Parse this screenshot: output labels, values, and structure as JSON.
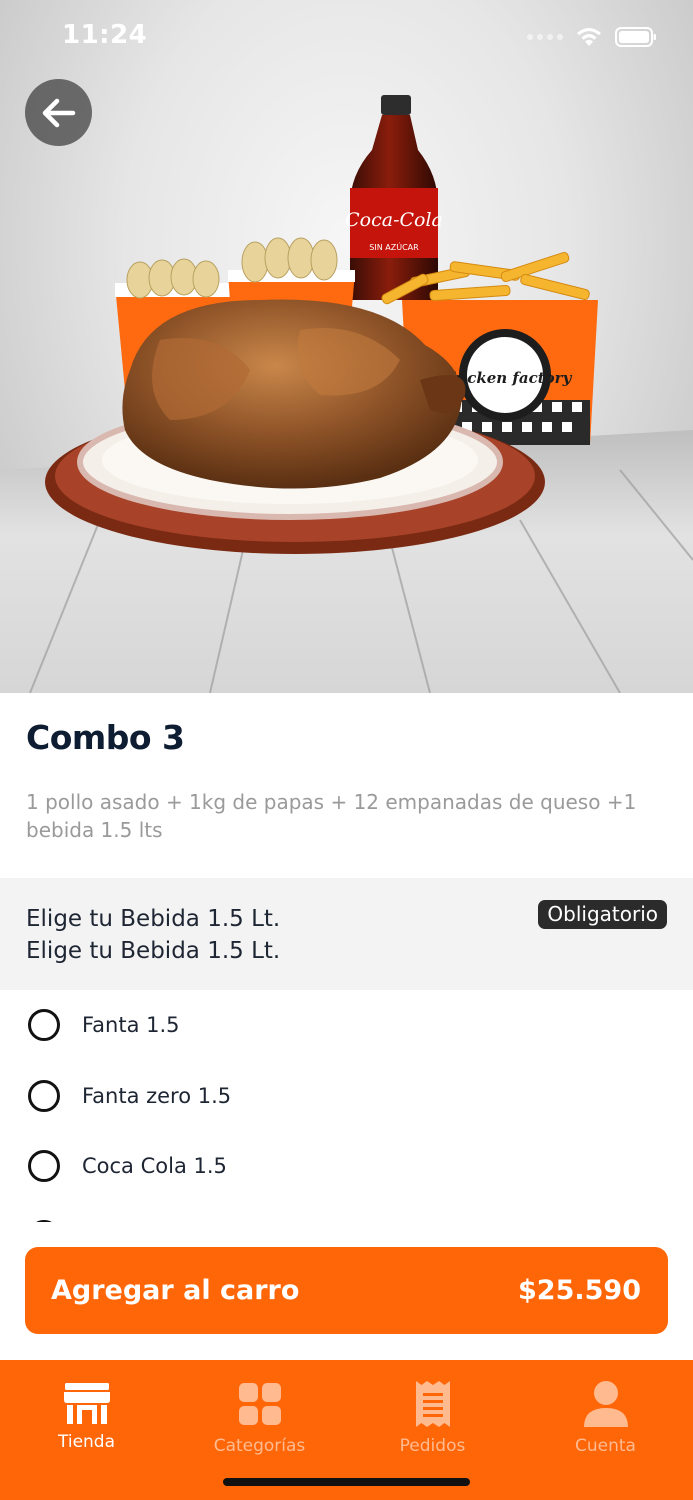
{
  "status_bar": {
    "time": "11:24"
  },
  "hero": {
    "back_icon": "arrow-left-icon",
    "product_image": "roast-chicken-combo-photo",
    "bottle_label": "Coca-Cola",
    "bottle_sublabel": "SIN AZÚCAR",
    "box_brand": "Chicken factory"
  },
  "product": {
    "name": "Combo 3",
    "description": "1 pollo asado + 1kg de papas + 12 empanadas de queso +1 bebida 1.5 lts"
  },
  "option_group": {
    "title_line1": "Elige tu Bebida 1.5 Lt.",
    "title_line2": "Elige tu Bebida 1.5 Lt.",
    "required_badge": "Obligatorio",
    "options": [
      {
        "label": "Fanta 1.5"
      },
      {
        "label": "Fanta zero 1.5"
      },
      {
        "label": "Coca Cola 1.5"
      },
      {
        "label": ""
      }
    ]
  },
  "cart": {
    "button_label": "Agregar al carro",
    "price": "$25.590"
  },
  "tab_bar": {
    "tabs": [
      {
        "label": "Tienda",
        "icon": "store-icon",
        "active": true
      },
      {
        "label": "Categorías",
        "icon": "grid-icon",
        "active": false
      },
      {
        "label": "Pedidos",
        "icon": "receipt-icon",
        "active": false
      },
      {
        "label": "Cuenta",
        "icon": "user-icon",
        "active": false
      }
    ]
  },
  "colors": {
    "brand_orange": "#ff6608",
    "title_navy": "#0f1d33",
    "badge_dark": "#2b2b2b",
    "muted_text": "#9a9a9a"
  }
}
